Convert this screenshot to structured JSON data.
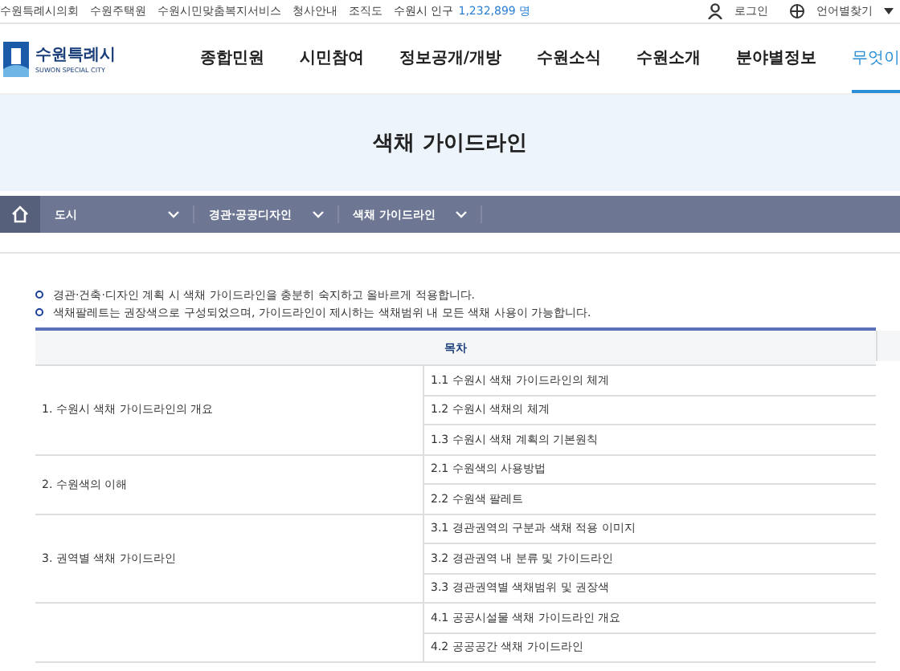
{
  "top_bar": {
    "links": [
      "수원특례시의회",
      "수원주택원",
      "수원시민맞춤복지서비스",
      "청사안내",
      "조직도"
    ],
    "population_label": "수원시 인구",
    "population_value": "1,232,899 명",
    "login": "로그인",
    "language": "언어별찾기"
  },
  "header": {
    "logo_name": "수원특례시",
    "logo_sub": "SUWON SPECIAL CITY",
    "nav": [
      {
        "label": "종합민원",
        "selected": false
      },
      {
        "label": "시민참여",
        "selected": false
      },
      {
        "label": "정보공개/개방",
        "selected": false
      },
      {
        "label": "수원소식",
        "selected": false
      },
      {
        "label": "수원소개",
        "selected": false
      },
      {
        "label": "분야별정보",
        "selected": false
      },
      {
        "label": "무엇이",
        "selected": true
      }
    ]
  },
  "banner": {
    "title": "색채 가이드라인"
  },
  "breadcrumb": [
    "도시",
    "경관·공공디자인",
    "색채 가이드라인"
  ],
  "notes": [
    "경관·건축·디자인 계획 시 색채 가이드라인을 충분히 숙지하고 올바르게 적용합니다.",
    "색채팔레트는 권장색으로 구성되었으며, 가이드라인이 제시하는 색채범위 내 모든 색채 사용이 가능합니다."
  ],
  "table": {
    "header": "목차",
    "groups": [
      {
        "title": "1. 수원시 색채 가이드라인의 개요",
        "items": [
          "1.1 수원시 색채 가이드라인의 체계",
          "1.2 수원시 색채의 체계",
          "1.3 수원시 색채 계획의 기본원칙"
        ]
      },
      {
        "title": "2. 수원색의 이해",
        "items": [
          "2.1 수원색의 사용방법",
          "2.2 수원색 팔레트"
        ]
      },
      {
        "title": "3. 권역별 색채 가이드라인",
        "items": [
          "3.1 경관권역의 구분과 색채 적용 이미지",
          "3.2 경관권역 내 분류 및 가이드라인",
          "3.3 경관권역별 색채범위 및 권장색"
        ]
      },
      {
        "items": [
          "4.1 공공시설물 색채 가이드라인 개요",
          "4.2 공공공간 색채 가이드라인"
        ]
      }
    ]
  }
}
